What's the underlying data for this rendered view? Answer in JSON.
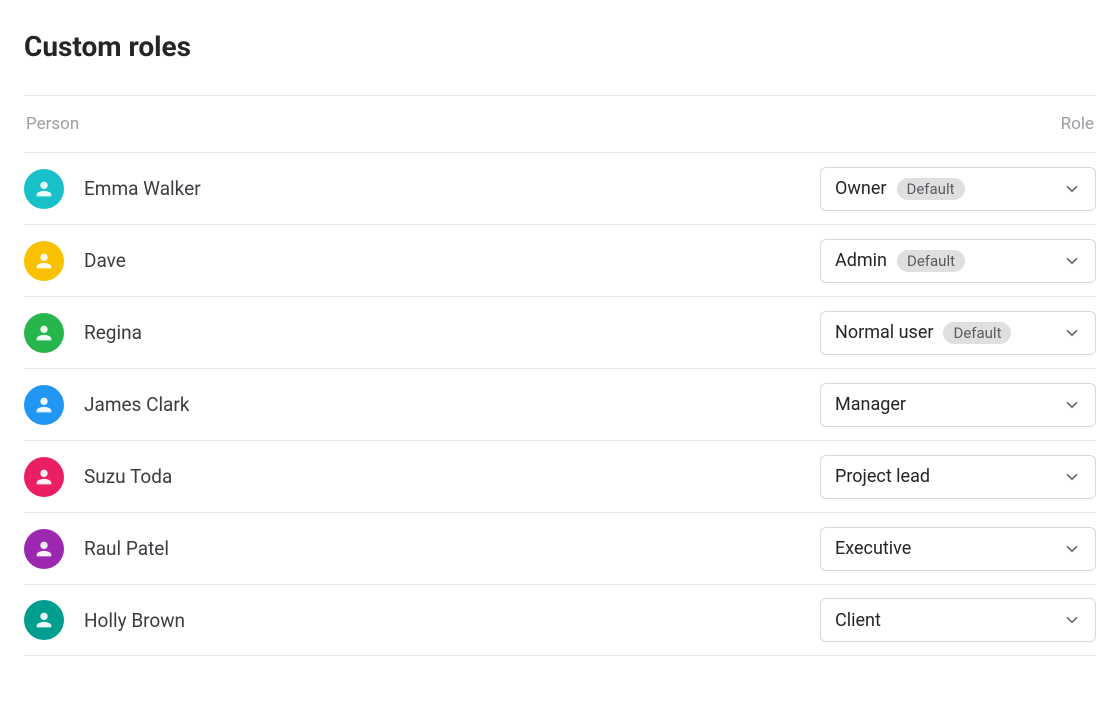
{
  "title": "Custom roles",
  "columns": {
    "person": "Person",
    "role": "Role"
  },
  "badge_default": "Default",
  "rows": [
    {
      "name": "Emma Walker",
      "role": "Owner",
      "default": true,
      "avatar_color": "#18c1c9"
    },
    {
      "name": "Dave",
      "role": "Admin",
      "default": true,
      "avatar_color": "#f8c200"
    },
    {
      "name": "Regina",
      "role": "Normal user",
      "default": true,
      "avatar_color": "#27b64b"
    },
    {
      "name": "James Clark",
      "role": "Manager",
      "default": false,
      "avatar_color": "#2196f3"
    },
    {
      "name": "Suzu Toda",
      "role": "Project lead",
      "default": false,
      "avatar_color": "#e91e63"
    },
    {
      "name": "Raul Patel",
      "role": "Executive",
      "default": false,
      "avatar_color": "#9c27b0"
    },
    {
      "name": "Holly Brown",
      "role": "Client",
      "default": false,
      "avatar_color": "#009e8e"
    }
  ]
}
